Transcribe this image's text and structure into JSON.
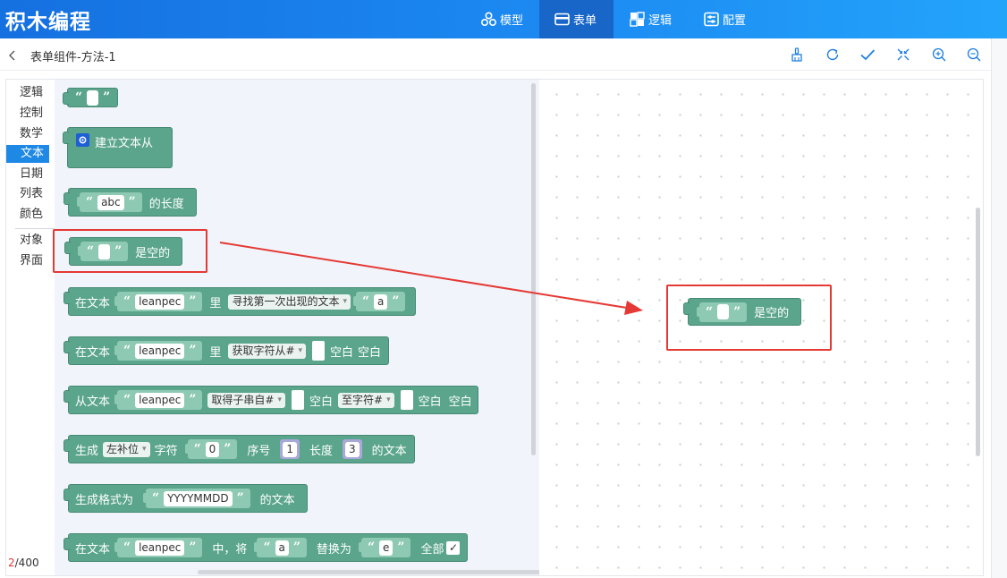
{
  "app": {
    "title": "积木编程"
  },
  "nav": {
    "tabs": [
      {
        "label": "模型",
        "icon": "model-icon"
      },
      {
        "label": "表单",
        "icon": "form-icon",
        "active": true
      },
      {
        "label": "逻辑",
        "icon": "logic-icon"
      },
      {
        "label": "配置",
        "icon": "config-icon"
      }
    ]
  },
  "subheader": {
    "title": "表单组件-方法-1",
    "tools": [
      "brush-icon",
      "refresh-icon",
      "check-icon",
      "collapse-icon",
      "zoom-in-icon",
      "zoom-out-icon"
    ]
  },
  "categories": [
    "逻辑",
    "控制",
    "数学",
    "文本",
    "日期",
    "列表",
    "颜色",
    "对象",
    "界面"
  ],
  "active_category": "文本",
  "counter": {
    "current": "2",
    "total": "/400"
  },
  "blocks": {
    "b2": {
      "label": "建立文本从"
    },
    "b3": {
      "value": "abc",
      "label": "的长度"
    },
    "b4": {
      "label": "是空的"
    },
    "b5": {
      "prefix": "在文本",
      "value": "leanpec",
      "mid": "里",
      "dropdown": "寻找第一次出现的文本",
      "arg": "a"
    },
    "b6": {
      "prefix": "在文本",
      "value": "leanpec",
      "mid": "里",
      "dropdown": "获取字符从#",
      "suffix1": "空白",
      "suffix2": "空白"
    },
    "b7": {
      "prefix": "从文本",
      "value": "leanpec",
      "dropdown1": "取得子串自#",
      "suffix1": "空白",
      "dropdown2": "至字符#",
      "suffix2": "空白",
      "suffix3": "空白"
    },
    "b8": {
      "prefix": "生成",
      "dropdown": "左补位",
      "l1": "字符",
      "char": "0",
      "l2": "序号",
      "index": "1",
      "l3": "长度",
      "length": "3",
      "l4": "的文本"
    },
    "b9": {
      "prefix": "生成格式为",
      "value": "YYYYMMDD",
      "suffix": "的文本"
    },
    "b10": {
      "prefix": "在文本",
      "value": "leanpec",
      "mid": "中，将",
      "from": "a",
      "l2": "替换为",
      "to": "e",
      "l3": "全部",
      "checked": "✓"
    }
  },
  "canvas_block": {
    "label": "是空的"
  },
  "colors": {
    "block": "#5ba58c",
    "text_slot": "#8ec9b4",
    "number_slot": "#a9a9d8",
    "highlight": "#e53935",
    "topbar": "#1c8af2"
  }
}
